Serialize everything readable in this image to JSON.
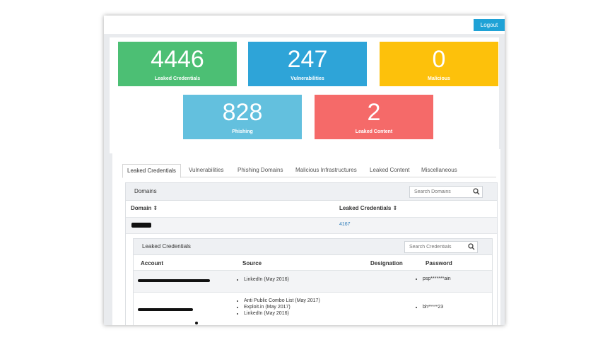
{
  "header": {
    "logout_label": "Logout"
  },
  "tiles": [
    {
      "value": "4446",
      "label": "Leaked Credentials",
      "color": "#4cbf74"
    },
    {
      "value": "247",
      "label": "Vulnerabilities",
      "color": "#2ea4d8"
    },
    {
      "value": "0",
      "label": "Malicious",
      "color": "#fdc10b"
    },
    {
      "value": "828",
      "label": "Phishing",
      "color": "#63c0de"
    },
    {
      "value": "2",
      "label": "Leaked Content",
      "color": "#f56a69"
    }
  ],
  "tabs": [
    "Leaked Credentials",
    "Vulnerabilities",
    "Phishing Domains",
    "Malicious Infrastructures",
    "Leaked Content",
    "Miscellaneous"
  ],
  "domains": {
    "title": "Domains",
    "search_placeholder": "Search Domains",
    "col_domain": "Domain ⇕",
    "col_leaked": "Leaked Credentials ⇕",
    "row_count": "4167"
  },
  "credentials": {
    "title": "Leaked Credentials",
    "search_placeholder": "Search Credentials",
    "col_account": "Account",
    "col_source": "Source",
    "col_designation": "Designation",
    "col_password": "Password",
    "rows": [
      {
        "sources": [
          "LinkedIn (May 2016)"
        ],
        "password": "psp*******ain"
      },
      {
        "sources": [
          "Anti Public Combo List (May 2017)",
          "Exploit.in (May 2017)",
          "LinkedIn (May 2016)"
        ],
        "password": "bh*****23"
      }
    ]
  }
}
